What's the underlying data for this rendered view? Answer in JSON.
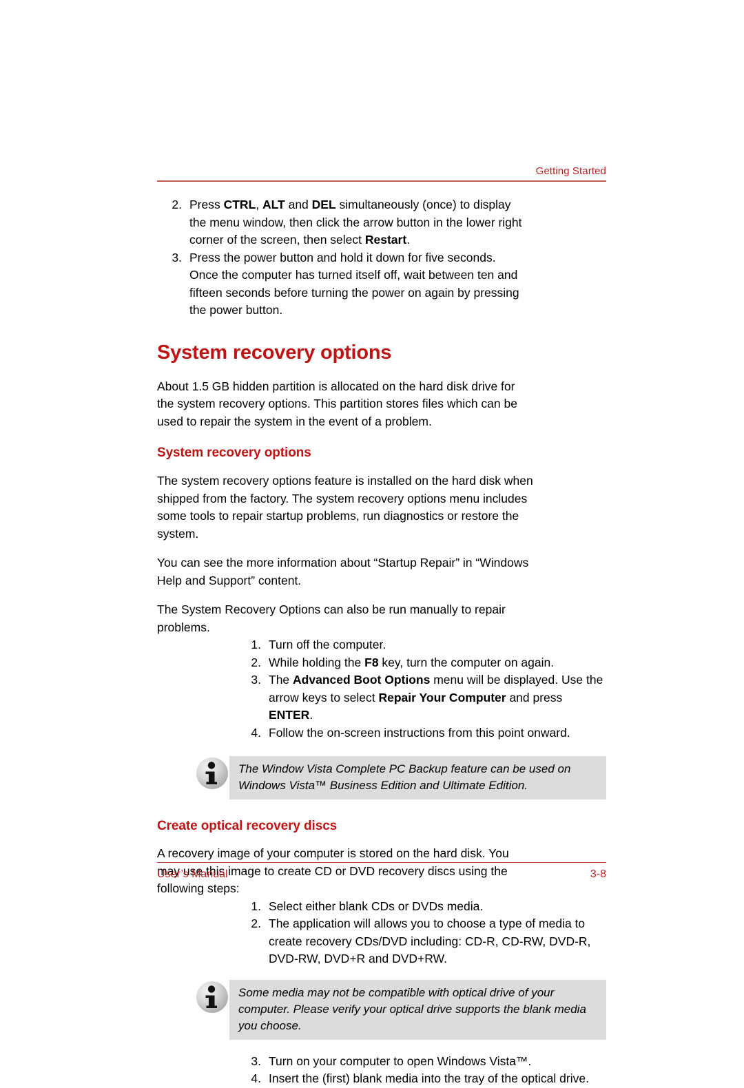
{
  "header": {
    "title": "Getting Started"
  },
  "top_steps": [
    {
      "num": "2.",
      "parts": [
        {
          "t": "Press ",
          "b": false
        },
        {
          "t": "CTRL",
          "b": true
        },
        {
          "t": ", ",
          "b": false
        },
        {
          "t": "ALT",
          "b": true
        },
        {
          "t": " and ",
          "b": false
        },
        {
          "t": "DEL",
          "b": true
        },
        {
          "t": " simultaneously (once) to display the menu window, then click the arrow button in the lower right corner of the screen, then select ",
          "b": false
        },
        {
          "t": "Restart",
          "b": true
        },
        {
          "t": ".",
          "b": false
        }
      ]
    },
    {
      "num": "3.",
      "parts": [
        {
          "t": "Press the power button and hold it down for five seconds. Once the computer has turned itself off, wait between ten and fifteen seconds before turning the power on again by pressing the power button.",
          "b": false
        }
      ]
    }
  ],
  "main_heading": "System recovery options",
  "intro_paragraph": "About 1.5 GB hidden partition is allocated on the hard disk drive for the system recovery options.  This partition stores files which can be used to repair the system in the event of a problem.",
  "section1": {
    "heading": "System recovery options",
    "paragraphs": [
      "The system recovery options feature is installed on the hard disk when shipped from the factory. The system recovery options menu includes some tools to repair startup problems, run diagnostics or restore the system.",
      "You can see the more information about “Startup Repair” in “Windows Help and Support” content.",
      "The System Recovery Options can also be run manually to repair problems."
    ],
    "steps": [
      {
        "num": "1.",
        "parts": [
          {
            "t": "Turn off the computer.",
            "b": false
          }
        ]
      },
      {
        "num": "2.",
        "parts": [
          {
            "t": "While holding the ",
            "b": false
          },
          {
            "t": "F8",
            "b": true
          },
          {
            "t": " key, turn the computer on again.",
            "b": false
          }
        ]
      },
      {
        "num": "3.",
        "parts": [
          {
            "t": "The ",
            "b": false
          },
          {
            "t": "Advanced Boot Options",
            "b": true
          },
          {
            "t": " menu will be displayed. Use the arrow keys to select ",
            "b": false
          },
          {
            "t": "Repair Your Computer",
            "b": true
          },
          {
            "t": " and press ",
            "b": false
          },
          {
            "t": "ENTER",
            "b": true
          },
          {
            "t": ".",
            "b": false
          }
        ]
      },
      {
        "num": "4.",
        "parts": [
          {
            "t": "Follow the on-screen instructions from this point onward.",
            "b": false
          }
        ]
      }
    ],
    "callout": "The Window Vista Complete PC Backup feature can be used on Windows Vista™ Business Edition and Ultimate Edition."
  },
  "section2": {
    "heading": "Create optical recovery discs",
    "paragraphs": [
      "A recovery image of your computer is stored on the hard disk. You may use this image to create CD or DVD recovery discs using the following steps:"
    ],
    "steps_before": [
      {
        "num": "1.",
        "parts": [
          {
            "t": "Select either blank CDs or DVDs media.",
            "b": false
          }
        ]
      },
      {
        "num": "2.",
        "parts": [
          {
            "t": "The application will allows you to choose a type of media to create recovery CDs/DVD including: CD-R, CD-RW, DVD-R, DVD-RW, DVD+R and DVD+RW.",
            "b": false
          }
        ]
      }
    ],
    "callout": "Some media may not be compatible with optical drive of your computer. Please verify your optical drive supports the blank media you choose.",
    "steps_after": [
      {
        "num": "3.",
        "parts": [
          {
            "t": "Turn on your computer to open Windows Vista™.",
            "b": false
          }
        ]
      },
      {
        "num": "4.",
        "parts": [
          {
            "t": "Insert the (first) blank media into the tray of the optical drive.",
            "b": false
          }
        ]
      }
    ]
  },
  "footer": {
    "left": "User’s Manual",
    "right": "3-8"
  },
  "colors": {
    "heading_red": "#BE1414",
    "header_red": "#B22222",
    "rule_red": "#C45A52",
    "callout_bg": "#DCDCDC"
  }
}
